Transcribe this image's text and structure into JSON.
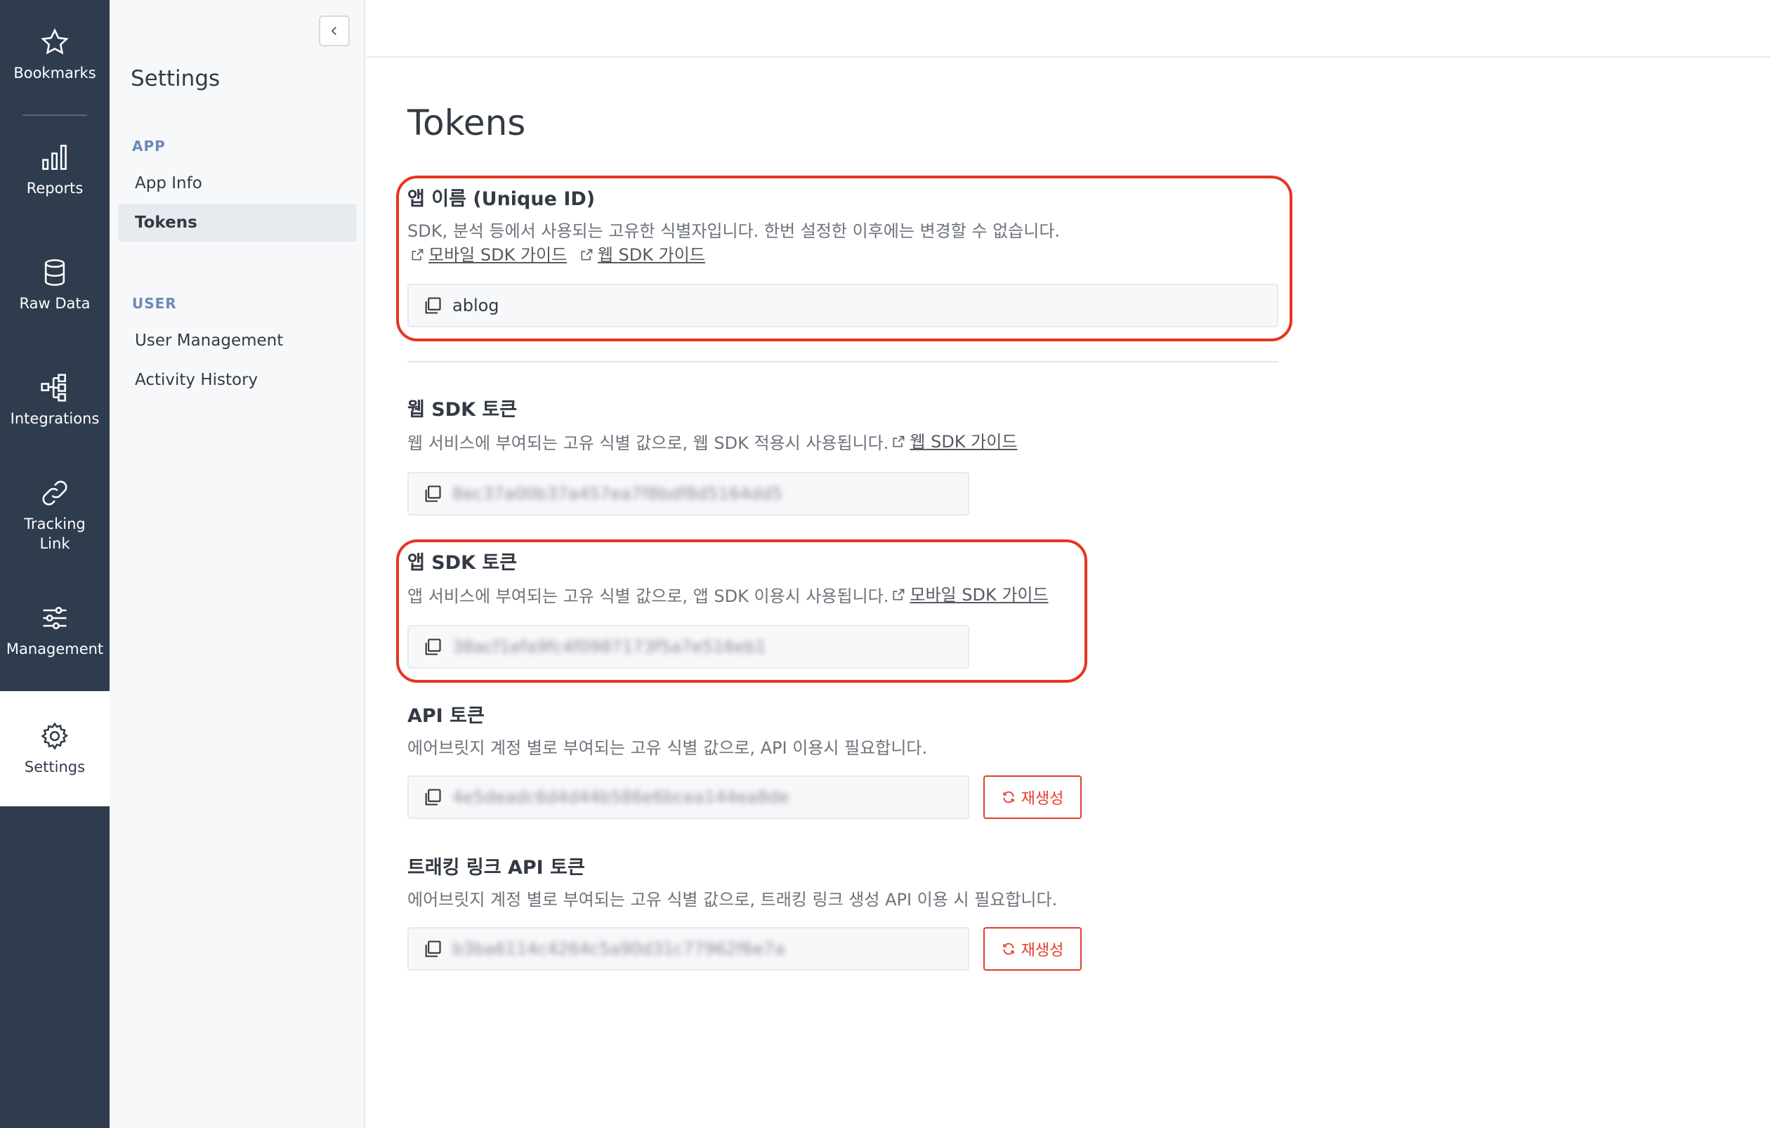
{
  "rail": {
    "items": [
      {
        "label": "Bookmarks",
        "icon": "star-icon"
      },
      {
        "label": "Reports",
        "icon": "bar-chart-icon"
      },
      {
        "label": "Raw Data",
        "icon": "database-icon"
      },
      {
        "label": "Integrations",
        "icon": "integrations-icon"
      },
      {
        "label": "Tracking\nLink",
        "icon": "link-icon"
      },
      {
        "label": "Management",
        "icon": "sliders-icon"
      },
      {
        "label": "Settings",
        "icon": "gear-icon"
      }
    ]
  },
  "sidebar": {
    "title": "Settings",
    "sections": [
      {
        "label": "APP",
        "items": [
          "App Info",
          "Tokens"
        ]
      },
      {
        "label": "USER",
        "items": [
          "User Management",
          "Activity History"
        ]
      }
    ],
    "selected": "Tokens"
  },
  "main": {
    "title": "Tokens",
    "app_name": {
      "title": "앱 이름 (Unique ID)",
      "desc": "SDK, 분석 등에서 사용되는 고유한 식별자입니다. 한번 설정한 이후에는 변경할 수 없습니다.",
      "link1": "모바일 SDK 가이드",
      "link2": "웹 SDK 가이드",
      "value": "ablog"
    },
    "web_sdk": {
      "title": "웹 SDK 토큰",
      "desc": "웹 서비스에 부여되는 고유 식별 값으로, 웹 SDK 적용시 사용됩니다.",
      "link": "웹 SDK 가이드",
      "value": "8ec37a00b37a457ea7f8bdf8d5164dd5"
    },
    "app_sdk": {
      "title": "앱 SDK 토큰",
      "desc": "앱 서비스에 부여되는 고유 식별 값으로, 앱 SDK 이용시 사용됩니다.",
      "link": "모바일 SDK 가이드",
      "value": "38acf1efa9fc4f0987173f5a7e516eb1"
    },
    "api": {
      "title": "API 토큰",
      "desc": "에어브릿지 계정 별로 부여되는 고유 식별 값으로, API 이용시 필요합니다.",
      "value": "4e5deadc6d4d44b586e6bcea144ea8de",
      "regen_label": "재생성"
    },
    "tracking_api": {
      "title": "트래킹 링크 API 토큰",
      "desc": "에어브릿지 계정 별로 부여되는 고유 식별 값으로, 트래킹 링크 생성 API 이용 시 필요합니다.",
      "value": "b3ba6114c4264c5a90d31c77962f6e7a",
      "regen_label": "재생성"
    }
  },
  "colors": {
    "rail_bg": "#2f3c4e",
    "highlight": "#e8341f",
    "regen": "#e43b2f"
  }
}
